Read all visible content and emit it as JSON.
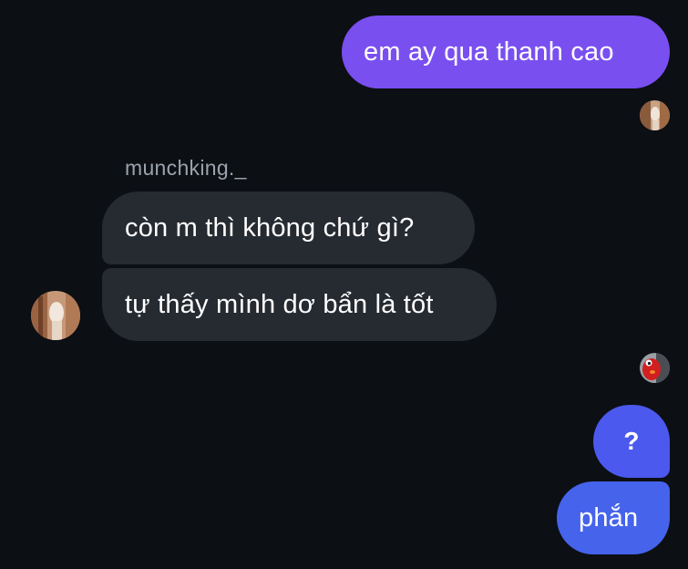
{
  "conversation": {
    "sender_name": "munchking._",
    "messages": [
      {
        "direction": "outgoing",
        "text": "em ay qua thanh cao"
      },
      {
        "direction": "incoming",
        "text": "còn m thì không chứ gì?"
      },
      {
        "direction": "incoming",
        "text": "tự thấy mình dơ bẩn là tốt"
      },
      {
        "direction": "outgoing",
        "text": "?"
      },
      {
        "direction": "outgoing",
        "text": "phắn"
      }
    ]
  },
  "colors": {
    "background": "#0c0f14",
    "outgoing_bubble_purple": "#7a4ff0",
    "outgoing_bubble_blue": "#4663ec",
    "incoming_bubble": "#262a31",
    "sender_name": "#9ba3ad"
  }
}
